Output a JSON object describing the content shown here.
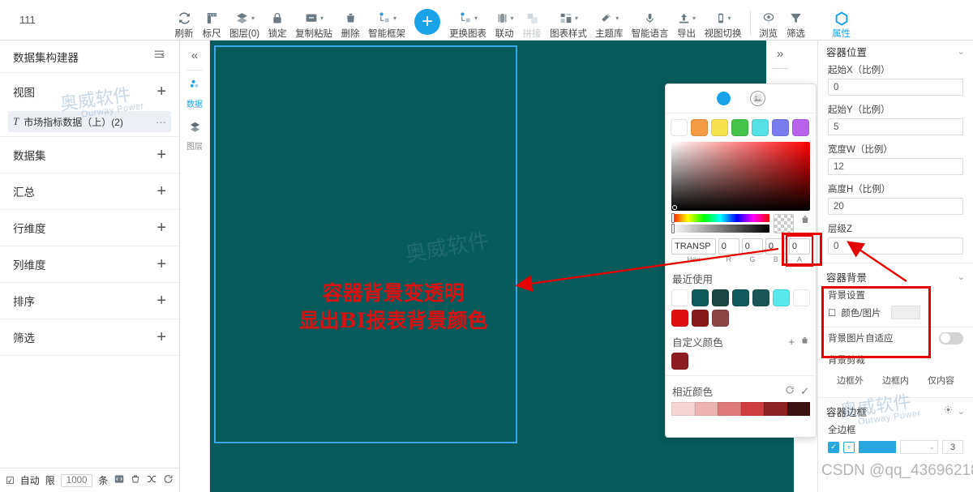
{
  "topbar": {
    "doc_title": "111",
    "tools": [
      {
        "label": "刷新",
        "icon": "refresh-icon",
        "caret": false,
        "dim": false
      },
      {
        "label": "标尺",
        "icon": "ruler-icon",
        "caret": false,
        "dim": false
      },
      {
        "label": "图层(0)",
        "icon": "layers-icon",
        "caret": true,
        "dim": false
      },
      {
        "label": "锁定",
        "icon": "lock-icon",
        "caret": false,
        "dim": false
      },
      {
        "label": "复制粘贴",
        "icon": "copy-paste-icon",
        "caret": true,
        "dim": false
      },
      {
        "label": "删除",
        "icon": "trash-icon",
        "caret": false,
        "dim": false
      },
      {
        "label": "智能框架",
        "icon": "smart-frame-icon",
        "caret": true,
        "dim": false
      }
    ],
    "tools2": [
      {
        "label": "更换图表",
        "icon": "swap-chart-icon",
        "caret": true,
        "dim": false
      },
      {
        "label": "联动",
        "icon": "link-icon",
        "caret": true,
        "dim": false
      },
      {
        "label": "拼接",
        "icon": "stitch-icon",
        "caret": false,
        "dim": true
      },
      {
        "label": "图表样式",
        "icon": "chart-style-icon",
        "caret": true,
        "dim": false
      },
      {
        "label": "主题库",
        "icon": "theme-brush-icon",
        "caret": true,
        "dim": false
      },
      {
        "label": "智能语言",
        "icon": "microphone-icon",
        "caret": false,
        "dim": false
      },
      {
        "label": "导出",
        "icon": "export-icon",
        "caret": true,
        "dim": false
      },
      {
        "label": "视图切换",
        "icon": "view-switch-icon",
        "caret": true,
        "dim": false
      },
      {
        "label": "浏览",
        "icon": "eye-icon",
        "caret": false,
        "dim": false
      },
      {
        "label": "筛选",
        "icon": "funnel-icon",
        "caret": false,
        "dim": false
      }
    ],
    "add_label": "+",
    "properties": {
      "label": "属性",
      "icon": "hexagon-icon",
      "active_color": "#1aa3e8"
    }
  },
  "left_panel": {
    "title": "数据集构建器",
    "collapse_icon": "collapse-list-icon",
    "sections": [
      {
        "label": "视图",
        "add": "+"
      },
      {
        "label": "数据集",
        "add": "+"
      },
      {
        "label": "汇总",
        "add": "+"
      },
      {
        "label": "行维度",
        "add": "+"
      },
      {
        "label": "列维度",
        "add": "+"
      },
      {
        "label": "排序",
        "add": "+"
      },
      {
        "label": "筛选",
        "add": "+"
      }
    ],
    "view_item": {
      "type_mark": "T",
      "name": "市场指标数据（上）(2)",
      "more": "···"
    },
    "footer": {
      "auto_label": "自动",
      "limit_label": "限",
      "limit_value": "1000",
      "unit_label": "条",
      "icons": [
        "code-icon",
        "trash-icon",
        "shuffle-icon",
        "refresh-icon"
      ]
    }
  },
  "rail": {
    "collapse_icon": "«",
    "items": [
      {
        "label": "数据",
        "icon": "data-dots-icon",
        "active": true
      },
      {
        "label": "图层",
        "icon": "layers-icon",
        "active": false
      }
    ]
  },
  "canvas": {
    "background_color": "#075b5b",
    "selection_border_color": "#3aa7f0",
    "annotation_line1": "容器背景变透明",
    "annotation_line2": "显出BI报表背景颜色",
    "annotation_color": "#d81212",
    "collapse_icon": "»",
    "watermark": "奥威软件"
  },
  "color_picker": {
    "tab_color_icon": "color-circle-icon",
    "tab_image_icon": "image-circle-icon",
    "presets": [
      "#ffffff",
      "#f59a42",
      "#f8e14e",
      "#44c34a",
      "#54e2e6",
      "#7b7bf0",
      "#b963ec"
    ],
    "current_swatch": "transparent-checker",
    "delete_icon": "trash-icon",
    "fields": [
      {
        "name": "Hex",
        "value": "TRANSP",
        "highlight": false
      },
      {
        "name": "R",
        "value": "0",
        "highlight": false
      },
      {
        "name": "G",
        "value": "0",
        "highlight": false
      },
      {
        "name": "B",
        "value": "0",
        "highlight": false
      },
      {
        "name": "A",
        "value": "0",
        "highlight": true
      }
    ],
    "recent_title": "最近使用",
    "recent": [
      "#ffffff",
      "#0f5b5b",
      "#1b4745",
      "#12595b",
      "#1a5655",
      "#56e8ea",
      "#ffffff",
      "#e01010",
      "#8a1a1a",
      "#8d4444"
    ],
    "custom_title": "自定义颜色",
    "custom_add_icon": "plus-icon",
    "custom_delete_icon": "trash-icon",
    "custom": [
      "#8f1c20"
    ],
    "near_title": "相近颜色",
    "near_refresh_icon": "refresh-icon",
    "near_check_icon": "check-icon",
    "near": [
      "#f4d4d4",
      "#edb2b2",
      "#dd7b7b",
      "#cf3e3e",
      "#8f2222",
      "#3d1111"
    ]
  },
  "properties": {
    "position_section": {
      "title": "容器位置",
      "chevron": "chevron-down-icon",
      "fields": [
        {
          "label": "起始X（比例）",
          "value": "0"
        },
        {
          "label": "起始Y（比例）",
          "value": "5"
        },
        {
          "label": "宽度W（比例）",
          "value": "12"
        },
        {
          "label": "高度H（比例）",
          "value": "20"
        },
        {
          "label": "层级Z",
          "value": "0"
        }
      ]
    },
    "background_section": {
      "title": "容器背景",
      "chevron": "chevron-down-icon",
      "setting_label": "背景设置",
      "checkbox_label": "颜色/图片",
      "checkbox_checked": false,
      "adapt_label": "背景图片自适应",
      "adapt_on": false,
      "crop_label": "背景剪裁",
      "crop_options": [
        "边框外",
        "边框内",
        "仅内容"
      ]
    },
    "border_section": {
      "title": "容器边框",
      "gear_icon": "gear-icon",
      "chevron": "chevron-down-icon",
      "all_border_label": "全边框",
      "border_width": "3"
    }
  },
  "watermarks": {
    "brand_big": "奥威软件",
    "brand_small": "Ourway Power",
    "csdn": "CSDN @qq_43696218"
  }
}
